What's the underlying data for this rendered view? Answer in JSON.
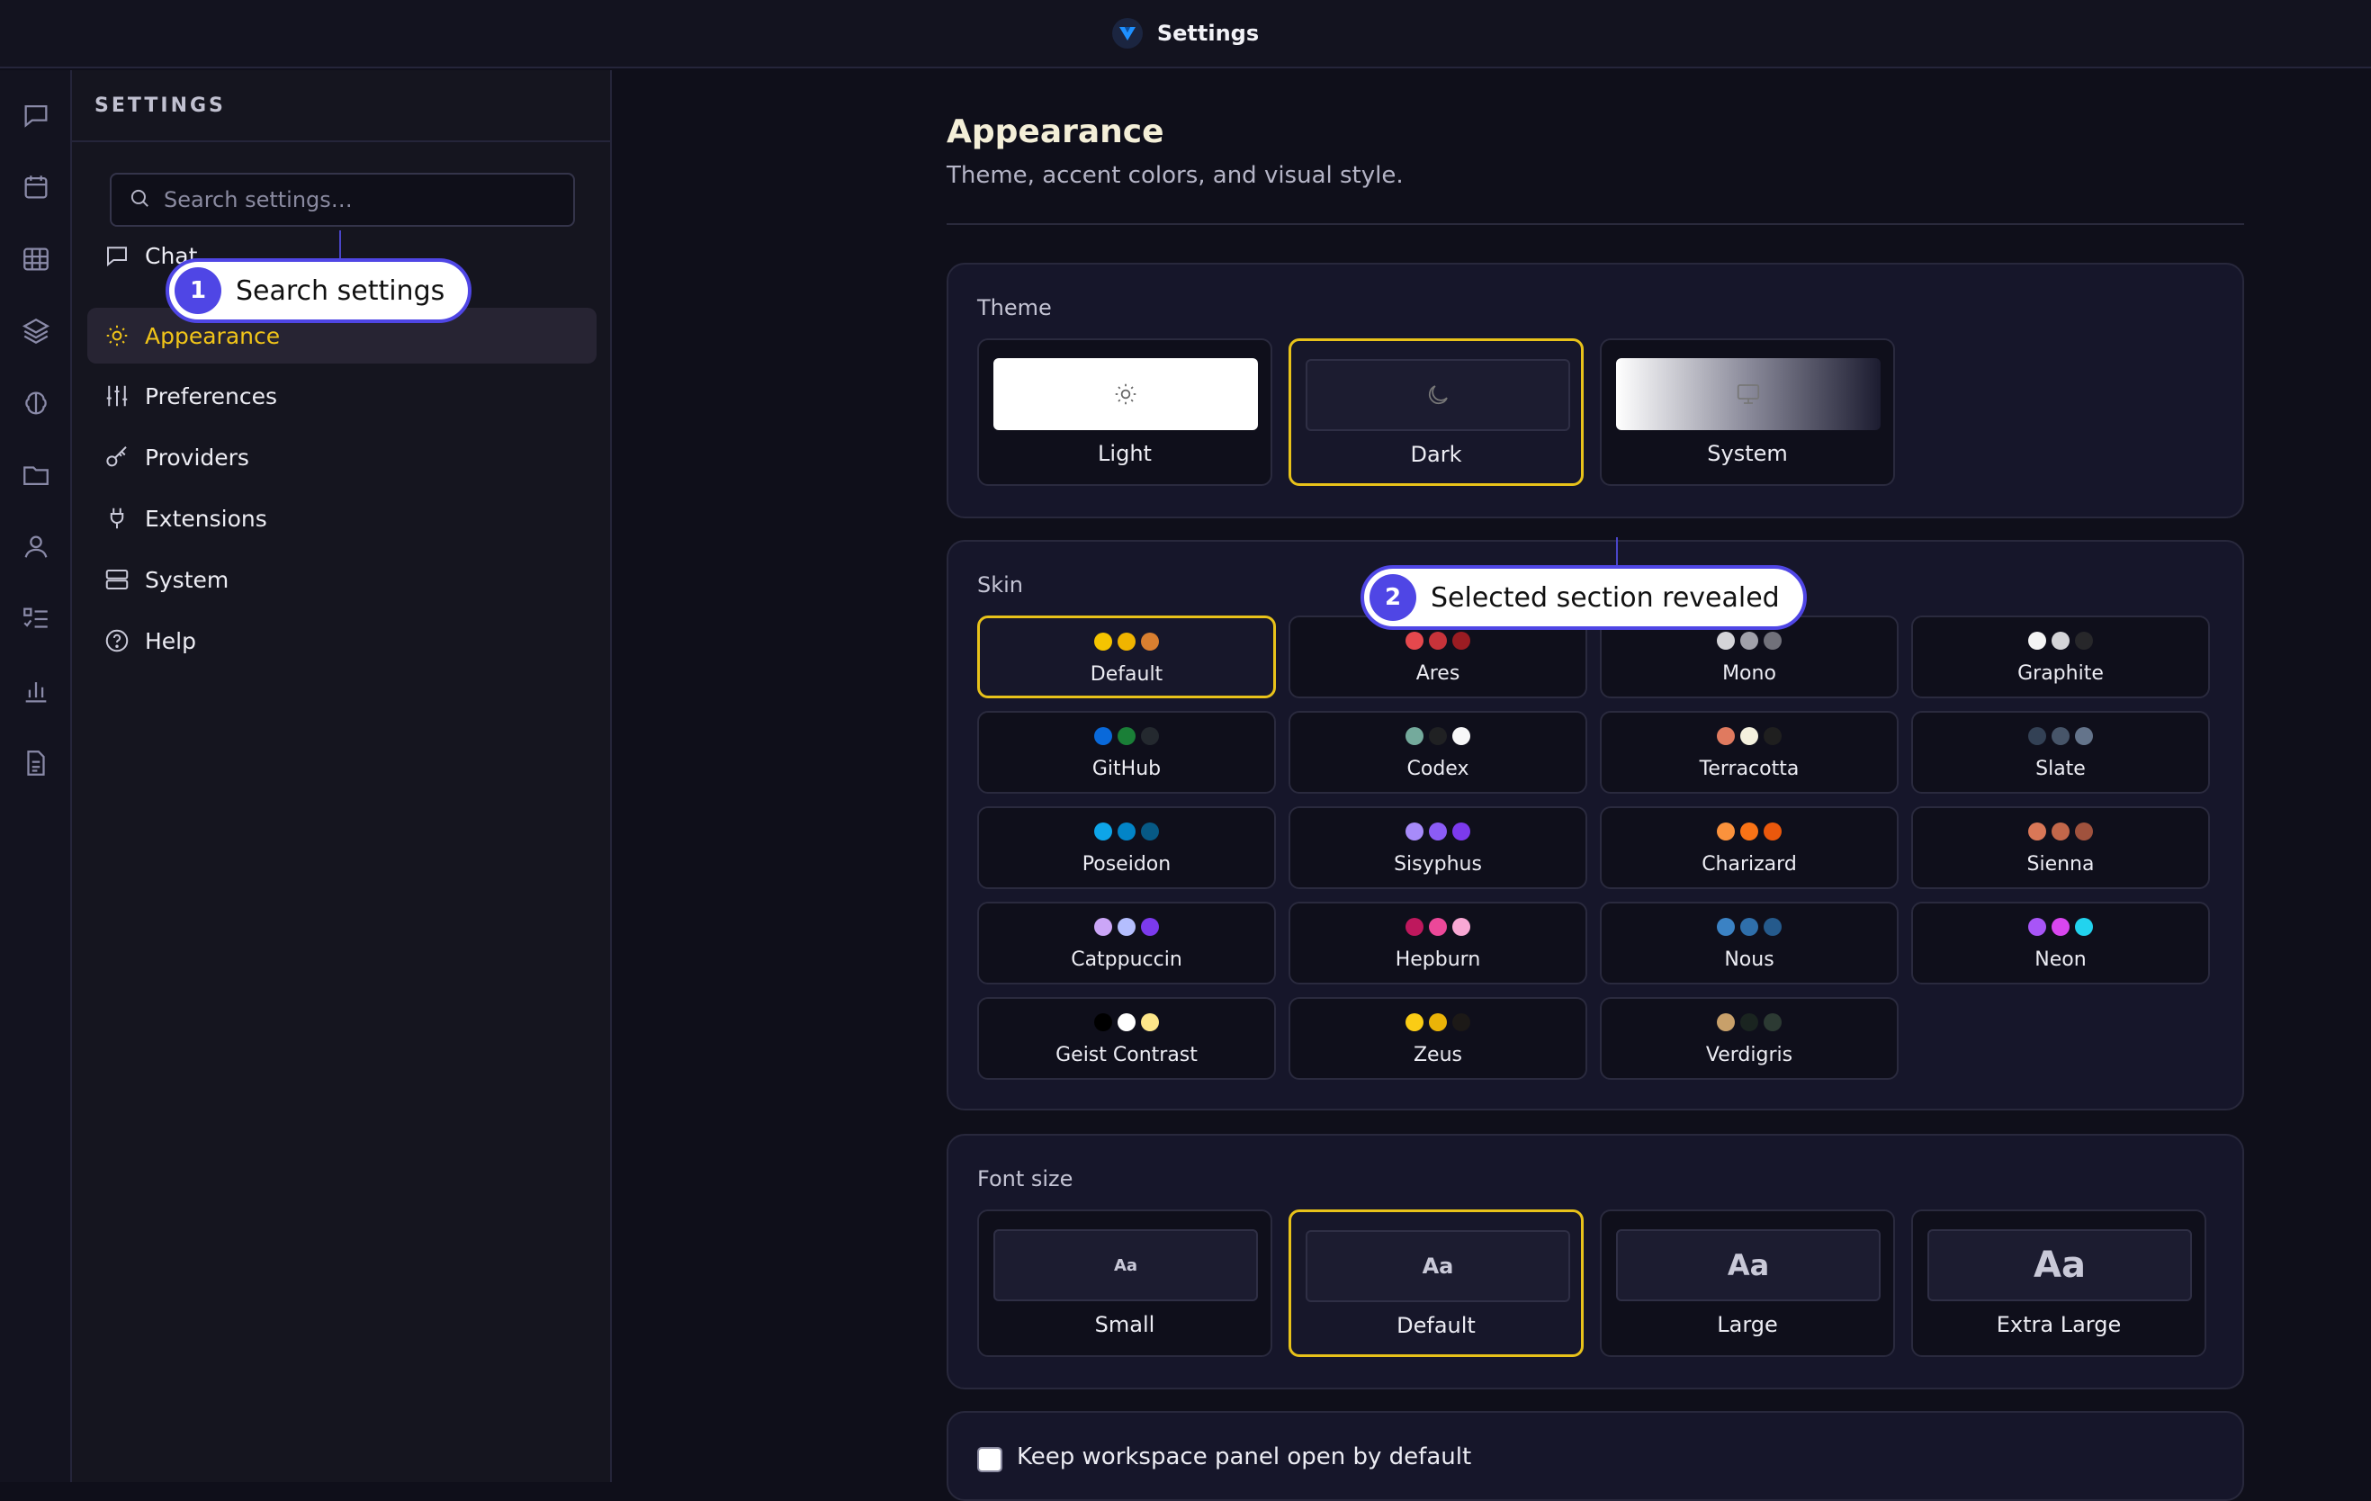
{
  "window": {
    "title": "Settings"
  },
  "rail": {
    "icons": [
      "chat-icon",
      "calendar-icon",
      "grid-icon",
      "layers-icon",
      "brain-icon",
      "folder-icon",
      "user-icon",
      "checklist-icon",
      "bar-chart-icon",
      "document-icon"
    ]
  },
  "sidebar": {
    "header": "SETTINGS",
    "search_placeholder": "Search settings…",
    "items": [
      {
        "label": "Chat",
        "icon": "chat-icon"
      },
      {
        "label": "Appearance",
        "icon": "sun-icon",
        "active": true
      },
      {
        "label": "Preferences",
        "icon": "sliders-icon"
      },
      {
        "label": "Providers",
        "icon": "key-icon"
      },
      {
        "label": "Extensions",
        "icon": "plug-icon"
      },
      {
        "label": "System",
        "icon": "server-icon"
      },
      {
        "label": "Help",
        "icon": "help-circle-icon"
      }
    ]
  },
  "callouts": [
    {
      "number": "1",
      "text": "Search settings"
    },
    {
      "number": "2",
      "text": "Selected section revealed"
    }
  ],
  "main": {
    "title": "Appearance",
    "subtitle": "Theme, accent colors, and visual style.",
    "theme": {
      "label": "Theme",
      "options": [
        {
          "label": "Light",
          "icon": "sun-icon",
          "selected": false
        },
        {
          "label": "Dark",
          "icon": "moon-icon",
          "selected": true
        },
        {
          "label": "System",
          "icon": "monitor-icon",
          "selected": false
        }
      ]
    },
    "skin": {
      "label": "Skin",
      "options": [
        {
          "label": "Default",
          "colors": [
            "#f5c400",
            "#f0b400",
            "#d97f30"
          ],
          "selected": true
        },
        {
          "label": "Ares",
          "colors": [
            "#e5484d",
            "#c7333a",
            "#9b1c22"
          ]
        },
        {
          "label": "Mono",
          "colors": [
            "#d4d4d8",
            "#a1a1aa",
            "#71717a"
          ]
        },
        {
          "label": "Graphite",
          "colors": [
            "#f4f4f5",
            "#d4d4d8",
            "#27272a"
          ]
        },
        {
          "label": "GitHub",
          "colors": [
            "#0969da",
            "#1a7f37",
            "#24292f"
          ]
        },
        {
          "label": "Codex",
          "colors": [
            "#74aa9c",
            "#202123",
            "#f7f7f8"
          ]
        },
        {
          "label": "Terracotta",
          "colors": [
            "#e07a5f",
            "#f4f1de",
            "#1f1f1f"
          ]
        },
        {
          "label": "Slate",
          "colors": [
            "#334155",
            "#475569",
            "#64748b"
          ]
        },
        {
          "label": "Poseidon",
          "colors": [
            "#0ea5e9",
            "#0284c7",
            "#075985"
          ]
        },
        {
          "label": "Sisyphus",
          "colors": [
            "#a78bfa",
            "#8b5cf6",
            "#7c3aed"
          ]
        },
        {
          "label": "Charizard",
          "colors": [
            "#fb923c",
            "#f97316",
            "#ea580c"
          ]
        },
        {
          "label": "Sienna",
          "colors": [
            "#d97757",
            "#c2674a",
            "#a0523d"
          ]
        },
        {
          "label": "Catppuccin",
          "colors": [
            "#cba6f7",
            "#b4befe",
            "#7c3aed"
          ]
        },
        {
          "label": "Hepburn",
          "colors": [
            "#be185d",
            "#ec4899",
            "#f9a8d4"
          ]
        },
        {
          "label": "Nous",
          "colors": [
            "#3b82c4",
            "#2f6fab",
            "#255a8c"
          ]
        },
        {
          "label": "Neon",
          "colors": [
            "#a855f7",
            "#d946ef",
            "#22d3ee"
          ]
        },
        {
          "label": "Geist Contrast",
          "colors": [
            "#000000",
            "#ffffff",
            "#fde68a"
          ]
        },
        {
          "label": "Zeus",
          "colors": [
            "#facc15",
            "#eab308",
            "#1c1917"
          ]
        },
        {
          "label": "Verdigris",
          "colors": [
            "#c8a06a",
            "#1a2420",
            "#2c3a33"
          ]
        }
      ]
    },
    "font_size": {
      "label": "Font size",
      "preview_text": "Aa",
      "options": [
        {
          "label": "Small",
          "selected": false
        },
        {
          "label": "Default",
          "selected": true
        },
        {
          "label": "Large",
          "selected": false
        },
        {
          "label": "Extra Large",
          "selected": false
        }
      ]
    },
    "keep_panel": {
      "label": "Keep workspace panel open by default",
      "checked": false
    }
  }
}
